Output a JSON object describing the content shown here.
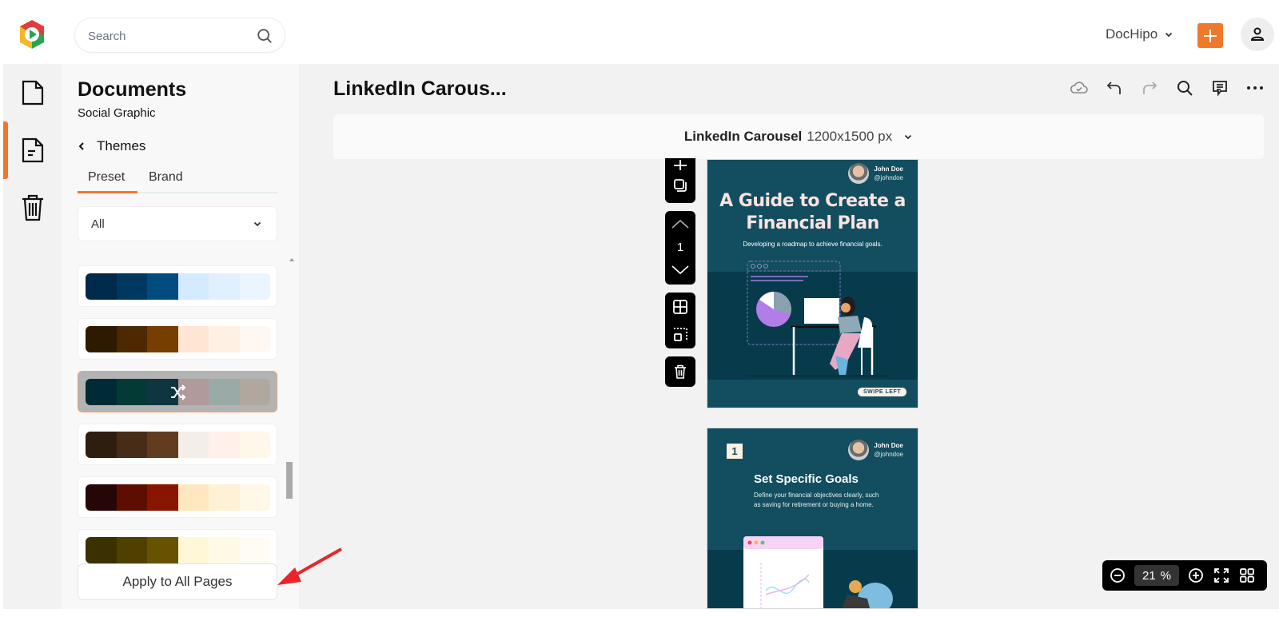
{
  "header": {
    "search_placeholder": "Search",
    "workspace_label": "DocHipo",
    "brand_accent": "#f0782a"
  },
  "rail": {
    "items": [
      {
        "name": "documents",
        "icon": "file-icon",
        "active": false
      },
      {
        "name": "document-text",
        "icon": "file-text-icon",
        "active": true
      },
      {
        "name": "trash",
        "icon": "trash-icon",
        "active": false
      }
    ]
  },
  "panel": {
    "title": "Documents",
    "subtitle": "Social Graphic",
    "back_label": "Themes",
    "tabs": [
      {
        "label": "Preset",
        "active": true
      },
      {
        "label": "Brand",
        "active": false
      }
    ],
    "filter_value": "All",
    "palettes": [
      {
        "colors": [
          "#002a4a",
          "#003862",
          "#004c7e",
          "#d4eafe",
          "#e0f0ff",
          "#ebf5ff"
        ],
        "selected": false
      },
      {
        "colors": [
          "#2e1a00",
          "#4d2800",
          "#763e00",
          "#ffe6d4",
          "#fff0e4",
          "#fff7f2"
        ],
        "selected": false
      },
      {
        "colors": [
          "#002a36",
          "#043a36",
          "#0e3540",
          "#b09a9a",
          "#9aaaa6",
          "#b0a89e"
        ],
        "selected": true
      },
      {
        "colors": [
          "#2e1e10",
          "#472c18",
          "#633c20",
          "#f4eee8",
          "#fff1ea",
          "#fff8ea"
        ],
        "selected": false
      },
      {
        "colors": [
          "#260606",
          "#5e0e00",
          "#881500",
          "#ffe8c0",
          "#fff1d6",
          "#fff8e8"
        ],
        "selected": false
      },
      {
        "colors": [
          "#3b3000",
          "#4f4000",
          "#665200",
          "#fff7d6",
          "#fffae6",
          "#fffcf4"
        ],
        "selected": false
      }
    ],
    "apply_label": "Apply to All Pages"
  },
  "main": {
    "doc_title": "LinkedIn Carous...",
    "size_name": "LinkedIn Carousel",
    "size_dims": "1200x1500 px",
    "page_number": "1",
    "zoom_value": "21",
    "zoom_unit": "%"
  },
  "slides": [
    {
      "author_name": "John Doe",
      "author_handle": "@johndoe",
      "title_line1": "A Guide to Create a",
      "title_line2": "Financial Plan",
      "subtitle": "Developing a roadmap to achieve financial goals.",
      "cta": "SWIPE LEFT"
    },
    {
      "badge": "1",
      "author_name": "John Doe",
      "author_handle": "@johndoe",
      "title": "Set Specific Goals",
      "body": "Define your financial objectives clearly, such as saving for retirement or buying a home."
    }
  ]
}
